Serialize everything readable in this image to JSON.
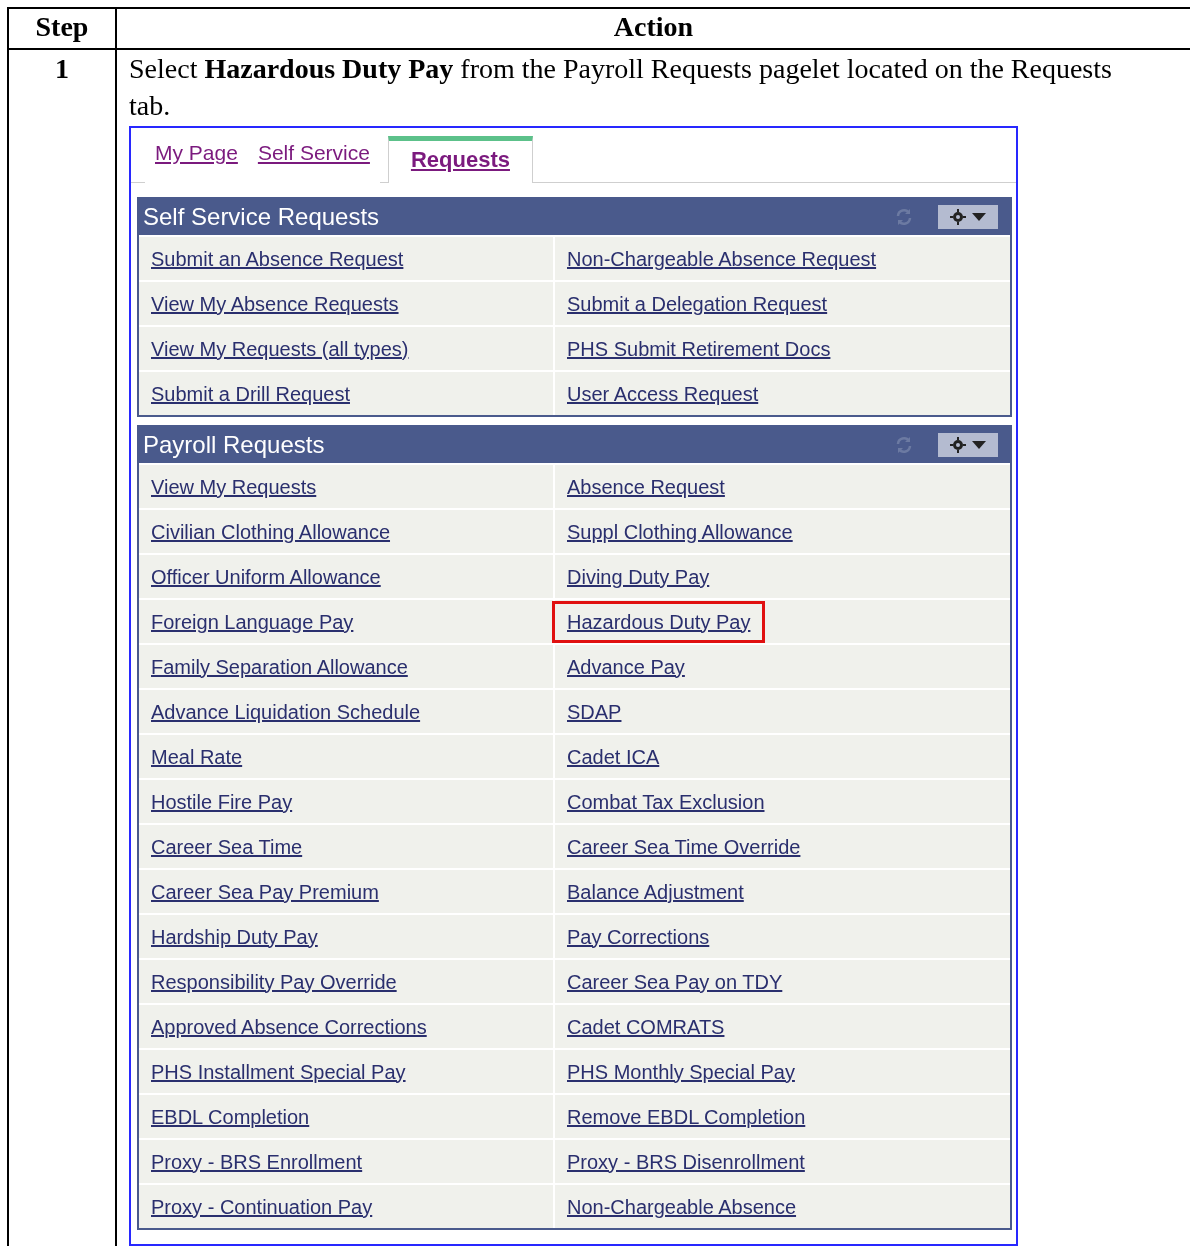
{
  "table": {
    "columns": [
      "Step",
      "Action"
    ],
    "rows": [
      {
        "step": "1",
        "instruction": "Select **Hazardous Duty Pay** from the Payroll Requests pagelet located on the Requests tab.",
        "screenshot": {
          "tabs": [
            {
              "label": "My Page",
              "selected": false
            },
            {
              "label": "Self Service",
              "selected": false
            },
            {
              "label": "Requests",
              "selected": true
            }
          ],
          "pagelets": [
            {
              "title": "Self Service Requests",
              "links": [
                {
                  "label": "Submit an Absence Request",
                  "highlighted": false
                },
                {
                  "label": "Non-Chargeable Absence Request",
                  "highlighted": false
                },
                {
                  "label": "View My Absence Requests",
                  "highlighted": false
                },
                {
                  "label": "Submit a Delegation Request",
                  "highlighted": false
                },
                {
                  "label": "View My Requests (all types)",
                  "highlighted": false
                },
                {
                  "label": "PHS Submit Retirement Docs",
                  "highlighted": false
                },
                {
                  "label": "Submit a Drill Request",
                  "highlighted": false
                },
                {
                  "label": "User Access Request",
                  "highlighted": false
                }
              ]
            },
            {
              "title": "Payroll Requests",
              "links": [
                {
                  "label": "View My Requests",
                  "highlighted": false
                },
                {
                  "label": "Absence Request",
                  "highlighted": false
                },
                {
                  "label": "Civilian Clothing Allowance",
                  "highlighted": false
                },
                {
                  "label": "Suppl Clothing Allowance",
                  "highlighted": false
                },
                {
                  "label": "Officer Uniform Allowance",
                  "highlighted": false
                },
                {
                  "label": "Diving Duty Pay",
                  "highlighted": false
                },
                {
                  "label": "Foreign Language Pay",
                  "highlighted": false
                },
                {
                  "label": "Hazardous Duty Pay",
                  "highlighted": true
                },
                {
                  "label": "Family Separation Allowance",
                  "highlighted": false
                },
                {
                  "label": "Advance Pay",
                  "highlighted": false
                },
                {
                  "label": "Advance Liquidation Schedule",
                  "highlighted": false
                },
                {
                  "label": "SDAP",
                  "highlighted": false
                },
                {
                  "label": "Meal Rate",
                  "highlighted": false
                },
                {
                  "label": "Cadet ICA",
                  "highlighted": false
                },
                {
                  "label": "Hostile Fire Pay",
                  "highlighted": false
                },
                {
                  "label": "Combat Tax Exclusion",
                  "highlighted": false
                },
                {
                  "label": "Career Sea Time",
                  "highlighted": false
                },
                {
                  "label": "Career Sea Time Override",
                  "highlighted": false
                },
                {
                  "label": "Career Sea Pay Premium",
                  "highlighted": false
                },
                {
                  "label": "Balance Adjustment",
                  "highlighted": false
                },
                {
                  "label": "Hardship Duty Pay",
                  "highlighted": false
                },
                {
                  "label": "Pay Corrections",
                  "highlighted": false
                },
                {
                  "label": "Responsibility Pay Override",
                  "highlighted": false
                },
                {
                  "label": "Career Sea Pay on TDY",
                  "highlighted": false
                },
                {
                  "label": "Approved Absence Corrections",
                  "highlighted": false
                },
                {
                  "label": "Cadet COMRATS",
                  "highlighted": false
                },
                {
                  "label": "PHS Installment Special Pay",
                  "highlighted": false
                },
                {
                  "label": "PHS Monthly Special Pay",
                  "highlighted": false
                },
                {
                  "label": "EBDL Completion",
                  "highlighted": false
                },
                {
                  "label": "Remove EBDL Completion",
                  "highlighted": false
                },
                {
                  "label": "Proxy - BRS Enrollment",
                  "highlighted": false
                },
                {
                  "label": "Proxy - BRS Disenrollment",
                  "highlighted": false
                },
                {
                  "label": "Proxy - Continuation Pay",
                  "highlighted": false
                },
                {
                  "label": "Non-Chargeable Absence",
                  "highlighted": false
                }
              ]
            }
          ]
        }
      }
    ]
  }
}
